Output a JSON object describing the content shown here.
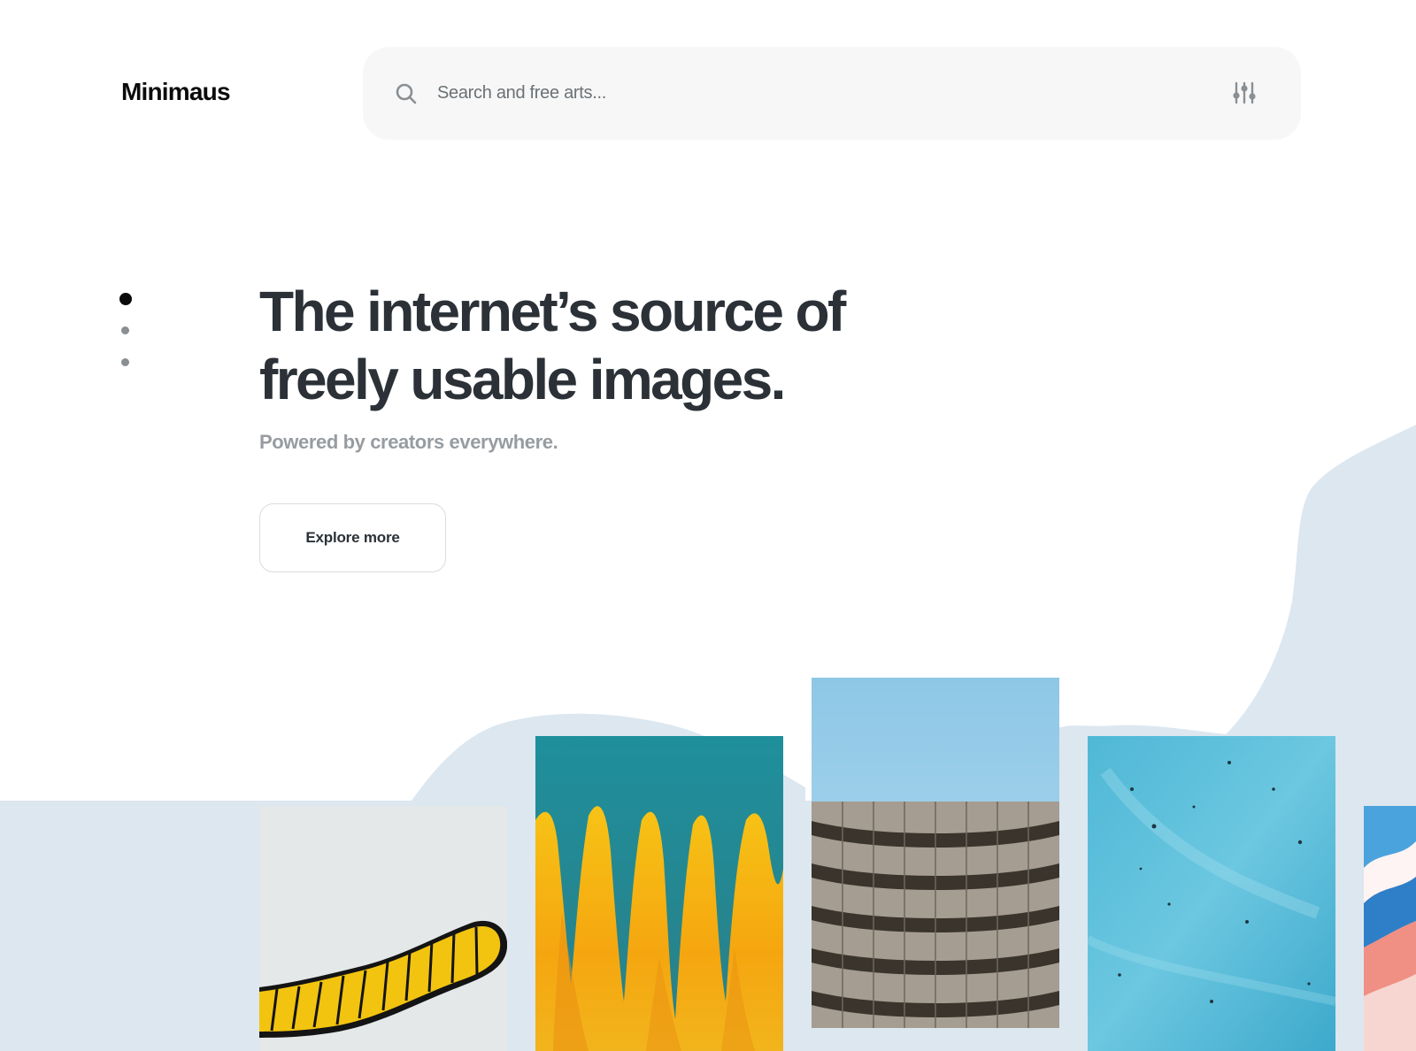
{
  "header": {
    "logo": "Minimaus",
    "search": {
      "placeholder": "Search and free arts...",
      "value": "",
      "search_icon": "search-icon",
      "filter_icon": "sliders-icon"
    }
  },
  "carousel": {
    "total_slides": 3,
    "active_slide": 1
  },
  "hero": {
    "title_line_1": "The internet’s source of",
    "title_line_2": "freely usable images.",
    "subtitle": "Powered by creators everywhere.",
    "cta_label": "Explore more"
  },
  "gallery": {
    "images": [
      "yellow-sculpture-image",
      "yellow-teal-paint-drip-image",
      "concrete-building-image",
      "blue-texture-image",
      "fluid-marble-art-image"
    ]
  },
  "colors": {
    "background": "#ffffff",
    "blob": "#dce7f0",
    "search_bg": "#f7f7f7",
    "title": "#2b3137",
    "subtitle": "#979ca1"
  }
}
